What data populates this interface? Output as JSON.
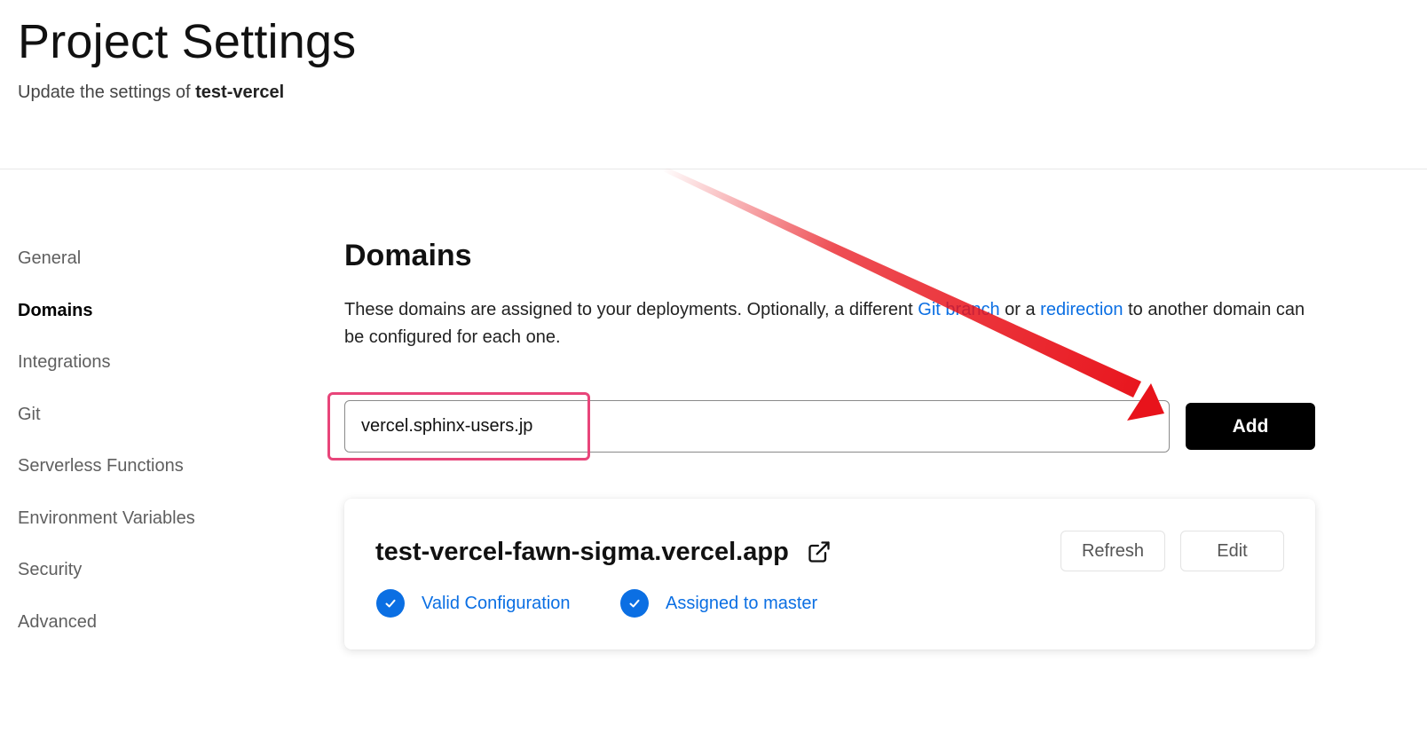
{
  "header": {
    "title": "Project Settings",
    "subtitle_prefix": "Update the settings of",
    "project_name": "test-vercel"
  },
  "sidebar": {
    "items": [
      {
        "label": "General"
      },
      {
        "label": "Domains",
        "active": true
      },
      {
        "label": "Integrations"
      },
      {
        "label": "Git"
      },
      {
        "label": "Serverless Functions"
      },
      {
        "label": "Environment Variables"
      },
      {
        "label": "Security"
      },
      {
        "label": "Advanced"
      }
    ]
  },
  "domains": {
    "title": "Domains",
    "description_part1": "These domains are assigned to your deployments. Optionally, a different",
    "git_branch_link": "Git branch",
    "description_or": "or a",
    "redirection_link": "redirection",
    "description_part2": "to another domain can be configured for each one.",
    "input_value": "vercel.sphinx-users.jp",
    "add_label": "Add",
    "card": {
      "domain": "test-vercel-fawn-sigma.vercel.app",
      "refresh_label": "Refresh",
      "edit_label": "Edit",
      "status_valid": "Valid Configuration",
      "status_assigned": "Assigned to master"
    }
  },
  "icons": {
    "external_link": "external-link-icon",
    "check": "check-circle-icon"
  },
  "colors": {
    "link_blue": "#0b6fe3",
    "primary_button": "#000000",
    "highlight_pink": "#e8457a",
    "annotation_red": "#e8131b"
  }
}
